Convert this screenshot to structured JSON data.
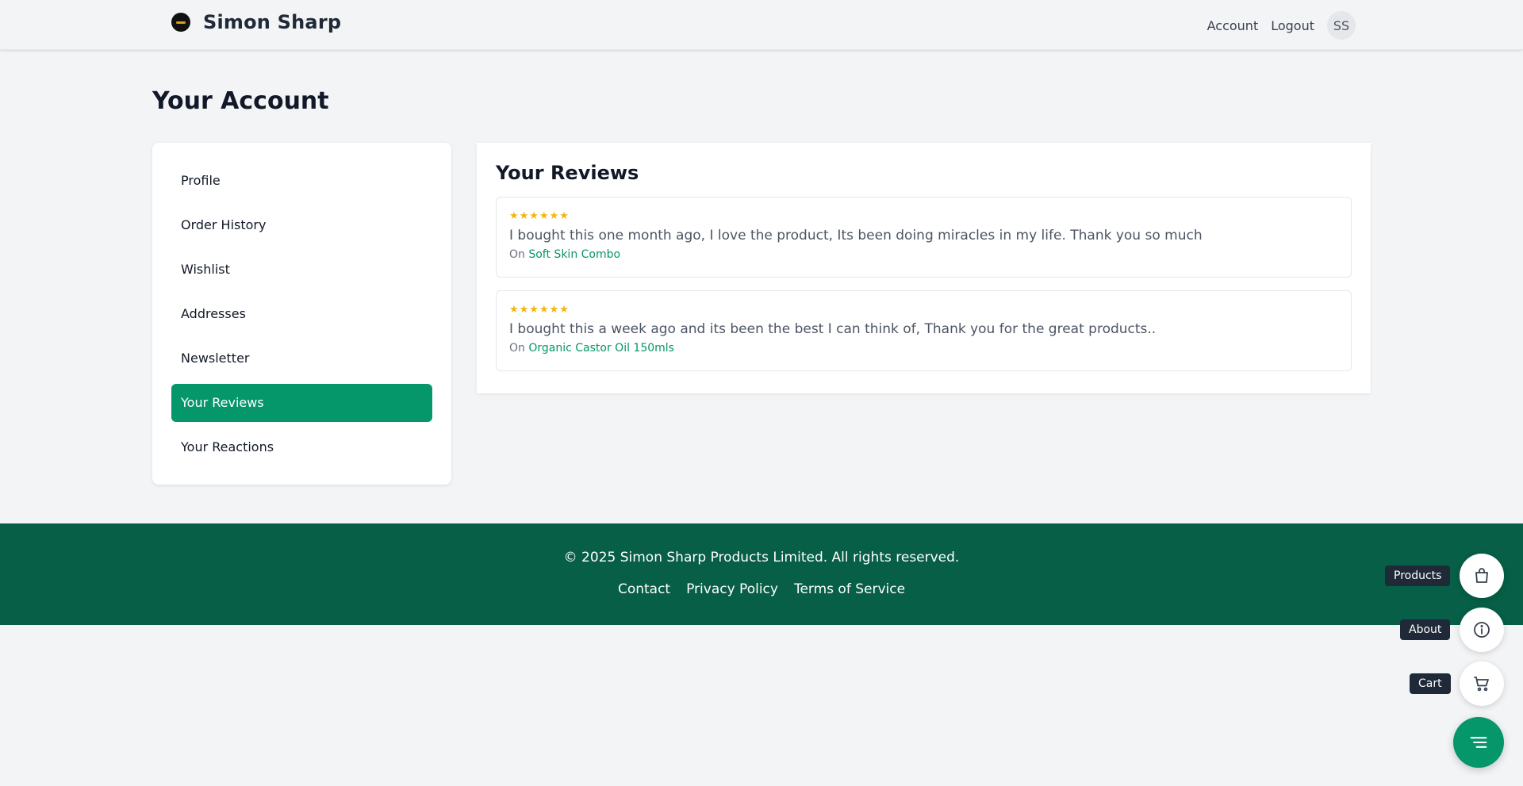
{
  "header": {
    "brand": "Simon Sharp",
    "nav": {
      "account": "Account",
      "logout": "Logout"
    },
    "avatar_initials": "SS"
  },
  "page": {
    "title": "Your Account"
  },
  "sidebar": {
    "items": [
      {
        "label": "Profile",
        "active": false
      },
      {
        "label": "Order History",
        "active": false
      },
      {
        "label": "Wishlist",
        "active": false
      },
      {
        "label": "Addresses",
        "active": false
      },
      {
        "label": "Newsletter",
        "active": false
      },
      {
        "label": "Your Reviews",
        "active": true
      },
      {
        "label": "Your Reactions",
        "active": false
      }
    ]
  },
  "reviews": {
    "title": "Your Reviews",
    "items": [
      {
        "stars": "★★★★★★",
        "text": "I bought this one month ago, I love the product, Its been doing miracles in my life. Thank you so much",
        "on_prefix": "On",
        "product": "Soft Skin Combo"
      },
      {
        "stars": "★★★★★★",
        "text": "I bought this a week ago and its been the best I can think of, Thank you for the great products..",
        "on_prefix": "On",
        "product": "Organic Castor Oil 150mls"
      }
    ]
  },
  "footer": {
    "copyright": "© 2025 Simon Sharp Products Limited. All rights reserved.",
    "links": [
      "Contact",
      "Privacy Policy",
      "Terms of Service"
    ]
  },
  "fab": {
    "products": "Products",
    "about": "About",
    "cart": "Cart"
  },
  "colors": {
    "accent": "#059669",
    "footer_bg": "#065f46",
    "star": "#f5b50a"
  }
}
